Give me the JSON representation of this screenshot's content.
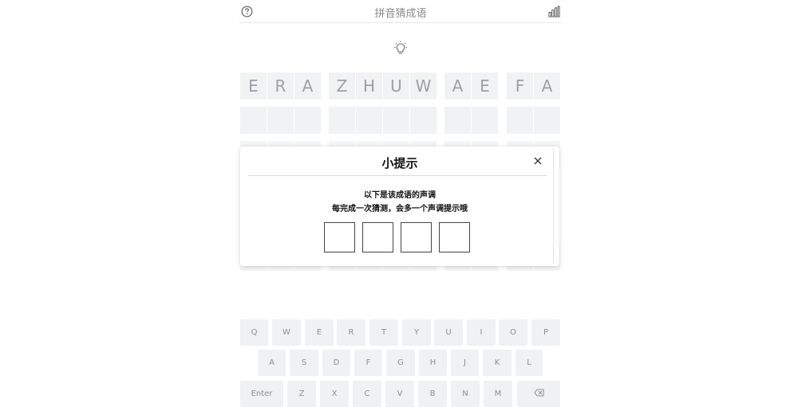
{
  "header": {
    "title": "拼音猜成语"
  },
  "icons": {
    "help": "help-circle-icon",
    "stats": "bar-chart-icon",
    "hint": "lightbulb-icon",
    "close": "close-icon",
    "backspace": "backspace-icon"
  },
  "grid": {
    "first_row": {
      "groups": [
        [
          "E",
          "R",
          "A"
        ],
        [
          "Z",
          "H",
          "U",
          "W"
        ],
        [
          "A",
          "E"
        ],
        [
          "F",
          "A"
        ]
      ]
    }
  },
  "modal": {
    "title": "小提示",
    "line1": "以下是该成语的声调",
    "line2": "每完成一次猜测，会多一个声调提示哦",
    "tones": [
      "",
      "",
      "",
      ""
    ]
  },
  "keyboard": {
    "row1": [
      "Q",
      "W",
      "E",
      "R",
      "T",
      "Y",
      "U",
      "I",
      "O",
      "P"
    ],
    "row2": [
      "A",
      "S",
      "D",
      "F",
      "G",
      "H",
      "J",
      "K",
      "L"
    ],
    "row3": [
      "Enter",
      "Z",
      "X",
      "C",
      "V",
      "B",
      "N",
      "M"
    ]
  },
  "colors": {
    "cell_bg": "#f1f2f3",
    "cell_text": "#9aa0a6",
    "key_bg": "#f0f1f2",
    "key_text": "#8a9096"
  }
}
